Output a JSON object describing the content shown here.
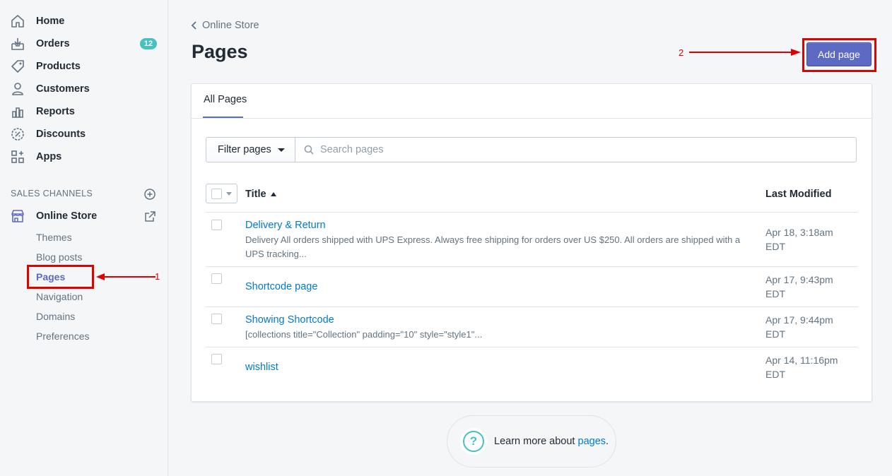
{
  "sidebar": {
    "items": [
      {
        "label": "Home",
        "icon": "home-icon"
      },
      {
        "label": "Orders",
        "icon": "orders-icon",
        "badge": "12"
      },
      {
        "label": "Products",
        "icon": "tag-icon"
      },
      {
        "label": "Customers",
        "icon": "person-icon"
      },
      {
        "label": "Reports",
        "icon": "bar-chart-icon"
      },
      {
        "label": "Discounts",
        "icon": "discount-icon"
      },
      {
        "label": "Apps",
        "icon": "apps-icon"
      }
    ],
    "sales_channels_title": "SALES CHANNELS",
    "online_store": "Online Store",
    "online_store_sub": [
      "Themes",
      "Blog posts",
      "Pages",
      "Navigation",
      "Domains",
      "Preferences"
    ]
  },
  "main": {
    "breadcrumb": "Online Store",
    "title": "Pages",
    "add_button": "Add page",
    "tab": "All Pages",
    "filter_label": "Filter pages",
    "search_placeholder": "Search pages",
    "col_title": "Title",
    "col_modified": "Last Modified",
    "rows": [
      {
        "title": "Delivery & Return",
        "excerpt": "Delivery All orders shipped with UPS Express. Always free shipping for orders over US $250. All orders are shipped with a UPS tracking...",
        "modified_date": "Apr 18, 3:18am",
        "modified_tz": "EDT"
      },
      {
        "title": "Shortcode page",
        "excerpt": "",
        "modified_date": "Apr 17, 9:43pm",
        "modified_tz": "EDT"
      },
      {
        "title": "Showing Shortcode",
        "excerpt": "[collections title=\"Collection\" padding=\"10\" style=\"style1\"...",
        "modified_date": "Apr 17, 9:44pm",
        "modified_tz": "EDT"
      },
      {
        "title": "wishlist",
        "excerpt": "",
        "modified_date": "Apr 14, 11:16pm",
        "modified_tz": "EDT"
      }
    ],
    "learn_text": "Learn more about ",
    "learn_link": "pages",
    "learn_end": "."
  },
  "annotations": {
    "pages_marker": "1",
    "add_page_marker": "2"
  },
  "colors": {
    "accent": "#5c6ac4",
    "link": "#007ace",
    "badge": "#47c1bf",
    "annotation": "#e00000"
  }
}
